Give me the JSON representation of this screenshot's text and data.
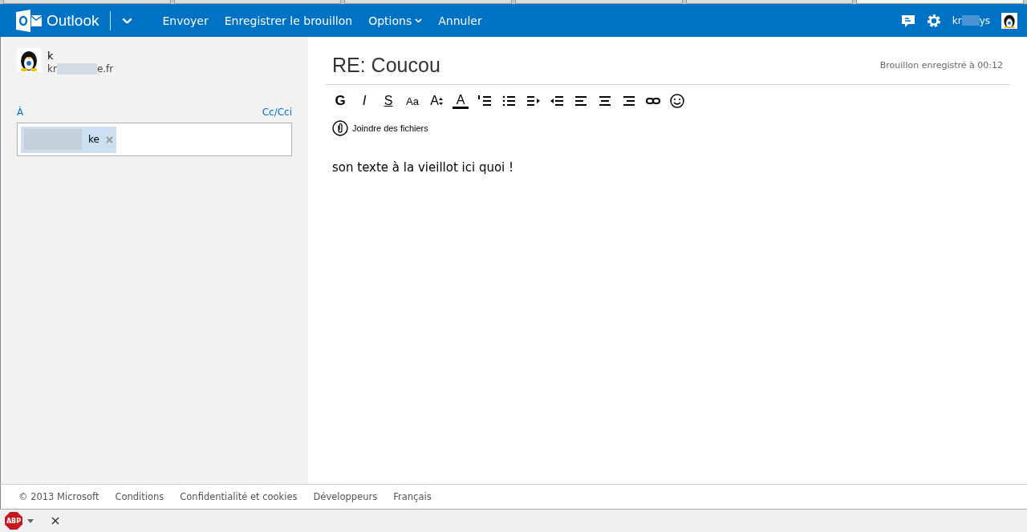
{
  "header": {
    "brand": "Outlook",
    "actions": [
      {
        "label": "Envoyer",
        "dropdown": false
      },
      {
        "label": "Enregistrer le brouillon",
        "dropdown": false
      },
      {
        "label": "Options",
        "dropdown": true
      },
      {
        "label": "Annuler",
        "dropdown": false
      }
    ],
    "user": {
      "name_start": "kr",
      "name_end": "ys"
    }
  },
  "sender": {
    "name": "k",
    "email_start": "kr",
    "email_end": "e.fr"
  },
  "recipients": {
    "label": "À",
    "cc_link": "Cc/Cci",
    "chips": [
      {
        "text": "ke"
      }
    ]
  },
  "message": {
    "subject": "RE: Coucou",
    "status": "Brouillon enregistré à 00:12",
    "format_buttons": [
      "G",
      "I",
      "S",
      "Aa",
      "A",
      "A"
    ],
    "attach": "Joindre des fichiers",
    "body": "son texte à la vieillot ici quoi !"
  },
  "footer": [
    "© 2013 Microsoft",
    "Conditions",
    "Confidentialité et cookies",
    "Développeurs",
    "Français"
  ],
  "addon_bar": {
    "badge": "ABP"
  }
}
